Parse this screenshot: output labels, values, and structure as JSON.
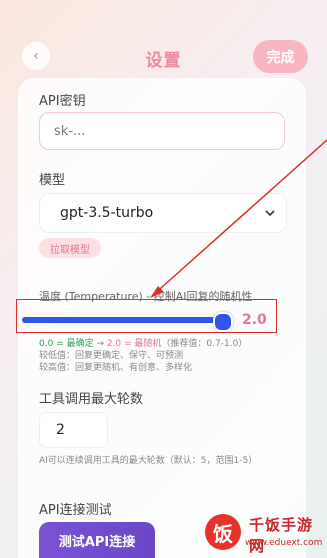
{
  "header": {
    "back_glyph": "‹",
    "title": "设置",
    "done_label": "完成"
  },
  "api_key": {
    "label": "API密钥",
    "placeholder": "sk-..."
  },
  "model": {
    "label": "模型",
    "selected": "gpt-3.5-turbo",
    "fetch_label": "拉取模型"
  },
  "temperature": {
    "label": "温度 (Temperature) - 控制AI回复的随机性",
    "value_text": "2.0",
    "level": 1.0,
    "hint_line1_a": "0.0 = 最确定",
    "hint_line1_arrow": " → ",
    "hint_line1_b": "2.0 = 最随机",
    "hint_line1_c": "（推荐值：0.7-1.0）",
    "hint_line2": "较低值：回复更确定、保守、可预测",
    "hint_line3": "较高值：回复更随机、有创意、多样化"
  },
  "tool_rounds": {
    "label": "工具调用最大轮数",
    "value": "2",
    "hint": "AI可以连续调用工具的最大轮数（默认：5，范围1-5）"
  },
  "api_test": {
    "label": "API连接测试",
    "button_label": "测试API连接"
  },
  "watermark": {
    "mark": "饭",
    "name": "千饭手游网",
    "url": "www.eduext.com"
  },
  "colors": {
    "accent": "#e7758e",
    "slider": "#2f55ea",
    "highlight": "#d9302a"
  },
  "icons": {
    "back": "chevron-left-icon",
    "select": "chevron-down-icon"
  }
}
